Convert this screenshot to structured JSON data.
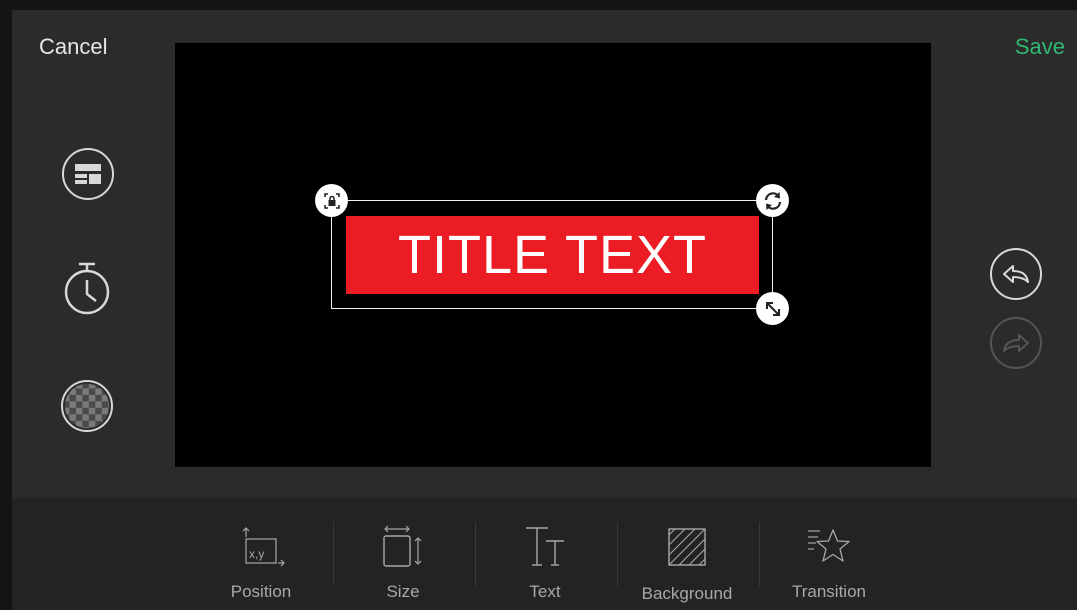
{
  "header": {
    "cancel_label": "Cancel",
    "save_label": "Save"
  },
  "canvas": {
    "title_text": "TITLE TEXT"
  },
  "side_tools": [
    "layout-icon",
    "timer-icon",
    "opacity-checker-icon"
  ],
  "history": [
    "undo-icon",
    "redo-icon"
  ],
  "toolbar": {
    "position_label": "Position",
    "position_icon_text": "x,y",
    "size_label": "Size",
    "text_label": "Text",
    "background_label": "Background",
    "transition_label": "Transition"
  },
  "colors": {
    "accent": "#2eb872",
    "title_background": "#ec1c24",
    "title_text": "#ffffff"
  }
}
